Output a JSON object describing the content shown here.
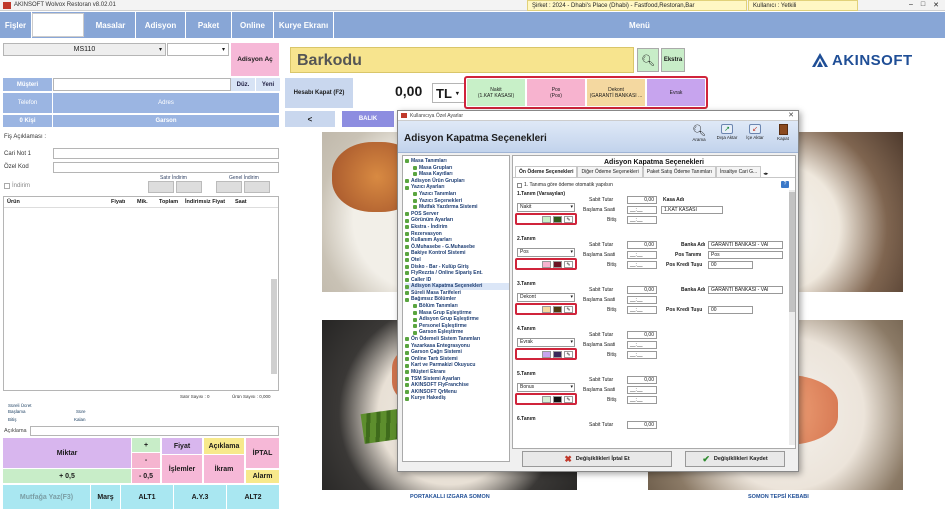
{
  "window": {
    "title": "AKINSOFT Wolvox Restoran v8.02.01",
    "company": "Şirket : 2024 - Dhabi's Place (Dhabi) - Fastfood,Restoran,Bar",
    "user": "Kullanıcı : Yetkili"
  },
  "menu": {
    "fisler": "Fişler",
    "masalar": "Masalar",
    "adisyon": "Adisyon",
    "paket": "Paket",
    "online": "Online",
    "kurye": "Kurye Ekranı",
    "menu": "Menü"
  },
  "left": {
    "table_select": "MS110",
    "adisyon_ac": "Adisyon Aç",
    "musteri": "Müşteri",
    "duz": "Düz.",
    "yeni": "Yeni",
    "telefon": "Telefon",
    "adres": "Adres",
    "kisi": "0 Kişi",
    "garson": "Garson",
    "fis_aciklamasi": "Fiş Açıklaması :",
    "cari_not": "Cari Not 1",
    "ozel_kod": "Özel Kod",
    "satir_indirim": "Satır İndirim",
    "genel_indirim": "Genel İndirim",
    "indirim": "İndirim",
    "cols": [
      "Ürün",
      "Fiyatı",
      "Mik.",
      "Toplam",
      "İndirimsiz Fiyat",
      "Saat"
    ],
    "satir_sayisi": "Satır Sayısı : 0",
    "urun_sayisi": "Ürün Sayısı : 0,000",
    "sure_uzat": "Süreli Ücret",
    "baslama": "Başlama",
    "bitis": "Bitiş",
    "sure": "Süre",
    "kalan": "Kalan",
    "aciklama": "Açıklama",
    "miktar": "Miktar",
    "plus": "+",
    "minus": "-",
    "plus05": "+ 0,5",
    "minus05": "- 0,5",
    "fiyat": "Fiyat",
    "aciklama_btn": "Açıklama",
    "ipt": "İPTAL",
    "islemler": "İşlemler",
    "ikram": "İkram",
    "alarm": "Alarm",
    "bottom": [
      "Mutfağa Yaz(F3)",
      "Marş",
      "ALT1",
      "A.Y.3",
      "ALT2"
    ]
  },
  "center": {
    "barkod": "Barkodu",
    "ekstra": "Ekstra",
    "hesabi_kapat": "Hesabı Kapat (F2)",
    "total": "0,00",
    "currency": "TL",
    "pay_methods": [
      {
        "label": "Nakit",
        "sub": "(1.KAT KASASI)",
        "color": "#c8f0c8"
      },
      {
        "label": "Pos",
        "sub": "(Pos)",
        "color": "#f7b3cf"
      },
      {
        "label": "Dekont",
        "sub": "(GARANTİ BANKASI ...",
        "color": "#f4d8a0"
      },
      {
        "label": "Evrak",
        "sub": "",
        "color": "#c7a4ee"
      }
    ],
    "back": "<",
    "balik": "BALIK",
    "logo": "AKINSOFT",
    "captions": [
      "PORTAKALLI IZGARA SOMON",
      "SOMON TEPSİ KEBABI"
    ]
  },
  "dialog": {
    "window_title": "Kullanıcıya Özel Ayarlar",
    "header": "Adisyon Kapatma Seçenekleri",
    "toolbar": [
      "Arama",
      "Dışa Aktar",
      "İçe Aktar",
      "Kapat"
    ],
    "tree": [
      {
        "t": "Masa Tanımları",
        "lvl": 0
      },
      {
        "t": "Masa Grupları",
        "lvl": 1
      },
      {
        "t": "Masa Kayıtları",
        "lvl": 1
      },
      {
        "t": "Adisyon Ürün Grupları",
        "lvl": 0
      },
      {
        "t": "Yazıcı Ayarları",
        "lvl": 0
      },
      {
        "t": "Yazıcı Tanımları",
        "lvl": 1
      },
      {
        "t": "Yazıcı Seçenekleri",
        "lvl": 1
      },
      {
        "t": "Mutfak Yazdırma Sistemi",
        "lvl": 1
      },
      {
        "t": "POS Server",
        "lvl": 0
      },
      {
        "t": "Görünüm Ayarları",
        "lvl": 0
      },
      {
        "t": "Ekstra - İndirim",
        "lvl": 0
      },
      {
        "t": "Rezervasyon",
        "lvl": 0
      },
      {
        "t": "Kullanım Ayarları",
        "lvl": 0
      },
      {
        "t": "Ö.Muhasebe - G.Muhasebe",
        "lvl": 0
      },
      {
        "t": "Bakiye Kontrol Sistemi",
        "lvl": 0
      },
      {
        "t": "Otel",
        "lvl": 0
      },
      {
        "t": "Disko - Bar - Kulüp Giriş",
        "lvl": 0
      },
      {
        "t": "FlyRezzta / Online Sipariş Ent.",
        "lvl": 0
      },
      {
        "t": "Caller ID",
        "lvl": 0
      },
      {
        "t": "Adisyon Kapatma Seçenekleri",
        "lvl": 0
      },
      {
        "t": "Süreli Masa Tarifeleri",
        "lvl": 0
      },
      {
        "t": "Bağımsız Bölümler",
        "lvl": 0
      },
      {
        "t": "Bölüm Tanımları",
        "lvl": 1
      },
      {
        "t": "Masa Grup Eşleştirme",
        "lvl": 1
      },
      {
        "t": "Adisyon Grup Eşleştirme",
        "lvl": 1
      },
      {
        "t": "Personel Eşleştirme",
        "lvl": 1
      },
      {
        "t": "Garson Eşleştirme",
        "lvl": 1
      },
      {
        "t": "Ön Ödemeli Sistem Tanımları",
        "lvl": 0
      },
      {
        "t": "Yazarkasa Entegrasyonu",
        "lvl": 0
      },
      {
        "t": "Garson Çağrı Sistemi",
        "lvl": 0
      },
      {
        "t": "Online Tartı Sistemi",
        "lvl": 0
      },
      {
        "t": "Kart ve Parmakizi Okuyucu",
        "lvl": 0
      },
      {
        "t": "Müşteri Ekranı",
        "lvl": 0
      },
      {
        "t": "TSM Sistemi Ayarları",
        "lvl": 0
      },
      {
        "t": "AKINSOFT FlyFranchise",
        "lvl": 0
      },
      {
        "t": "AKINSOFT QrMenu",
        "lvl": 0
      },
      {
        "t": "Kurye Hakediş",
        "lvl": 0
      }
    ],
    "panel_title": "Adisyon Kapatma Seçenekleri",
    "tabs": [
      "Ön Ödeme Seçenekleri",
      "Diğer Ödeme Seçenekleri",
      "Paket Satış Ödeme Tanımları",
      "İnsaltye Cari G..."
    ],
    "auto_check": "1. Tanıma göre ödeme otomatik yapılsın",
    "tanim_labels": [
      "1.Tanım (Varsayılan)",
      "2.Tanım",
      "3.Tanım",
      "4.Tanım",
      "5.Tanım",
      "6.Tanım"
    ],
    "rows": [
      {
        "name": "Nakit",
        "tutar": "0,00",
        "kasa_label": "Kasa Adı",
        "kasa": "1.KAT KASASI",
        "extra1": "",
        "extra2": "",
        "sw1": "#c8f0c8",
        "sw2": "#2e5a1a"
      },
      {
        "name": "Pos",
        "tutar": "0,00",
        "kasa_label": "Banka Adı",
        "kasa": "GARANTİ BANKASI - VAİ",
        "extra1_label": "Pos Tanımı",
        "extra1": "Pos",
        "extra2_label": "Pos Kredi Tuşu",
        "extra2": "00",
        "sw1": "#f7b3cf",
        "sw2": "#6b1325"
      },
      {
        "name": "Dekont",
        "tutar": "0,00",
        "kasa_label": "Banka Adı",
        "kasa": "GARANTİ BANKASI - VAİ",
        "extra2_label": "Pos Kredi Tuşu",
        "extra2": "00",
        "sw1": "#f4d8a0",
        "sw2": "#4d3a10"
      },
      {
        "name": "Evrak",
        "tutar": "0,00",
        "kasa_label": "",
        "kasa": "",
        "sw1": "#c7a4ee",
        "sw2": "#3b2a5a"
      },
      {
        "name": "Bonus",
        "tutar": "0,00",
        "kasa_label": "",
        "kasa": "",
        "sw1": "#d6eed6",
        "sw2": "#111111"
      }
    ],
    "sabit_tutar": "Sabit Tutar",
    "baslama_saati": "Başlama Saati",
    "bitis": "Bitiş",
    "time_placeholder": "__:__",
    "last_tutar": "0,00",
    "cancel": "Değişiklikleri İptal Et",
    "save": "Değişiklikleri Kaydet"
  }
}
